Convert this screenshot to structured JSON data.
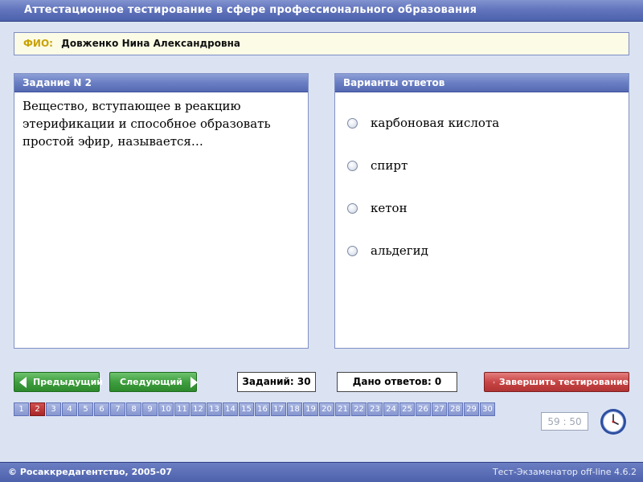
{
  "window": {
    "title": "Аттестационное тестирование в сфере профессионального образования"
  },
  "fio": {
    "label": "ФИО:",
    "name": "Довженко Нина Александровна"
  },
  "question": {
    "header": "Задание N 2",
    "text": "Вещество, вступающее в реакцию этерификации и способное образовать простой эфир, называется…"
  },
  "answers": {
    "header": "Варианты ответов",
    "options": [
      "карбоновая кислота",
      "спирт",
      "кетон",
      "альдегид"
    ]
  },
  "navigation": {
    "prev_label": "Предыдущий",
    "next_label": "Следующий"
  },
  "counters": {
    "tasks": "Заданий: 30",
    "answered": "Дано ответов: 0"
  },
  "finish": {
    "label": "Завершить тестирование"
  },
  "pages": {
    "numbers": [
      "1",
      "2",
      "3",
      "4",
      "5",
      "6",
      "7",
      "8",
      "9",
      "10",
      "11",
      "12",
      "13",
      "14",
      "15",
      "16",
      "17",
      "18",
      "19",
      "20",
      "21",
      "22",
      "23",
      "24",
      "25",
      "26",
      "27",
      "28",
      "29",
      "30"
    ],
    "current": "2"
  },
  "timer": {
    "value": "59 : 50"
  },
  "footer": {
    "copyright": "© Росаккредагентство, 2005-07",
    "version": "Тест-Экзаменатор off-line 4.6.2"
  },
  "colors": {
    "accent": "#5569b3",
    "nav_button": "#3f9e3f",
    "finish_button": "#c84545",
    "current_page": "#a92626",
    "fio_label": "#c9a200"
  },
  "icons": {
    "prev": "arrow-left-icon",
    "next": "arrow-right-icon",
    "finish": "running-man-icon",
    "timer": "clock-icon"
  }
}
